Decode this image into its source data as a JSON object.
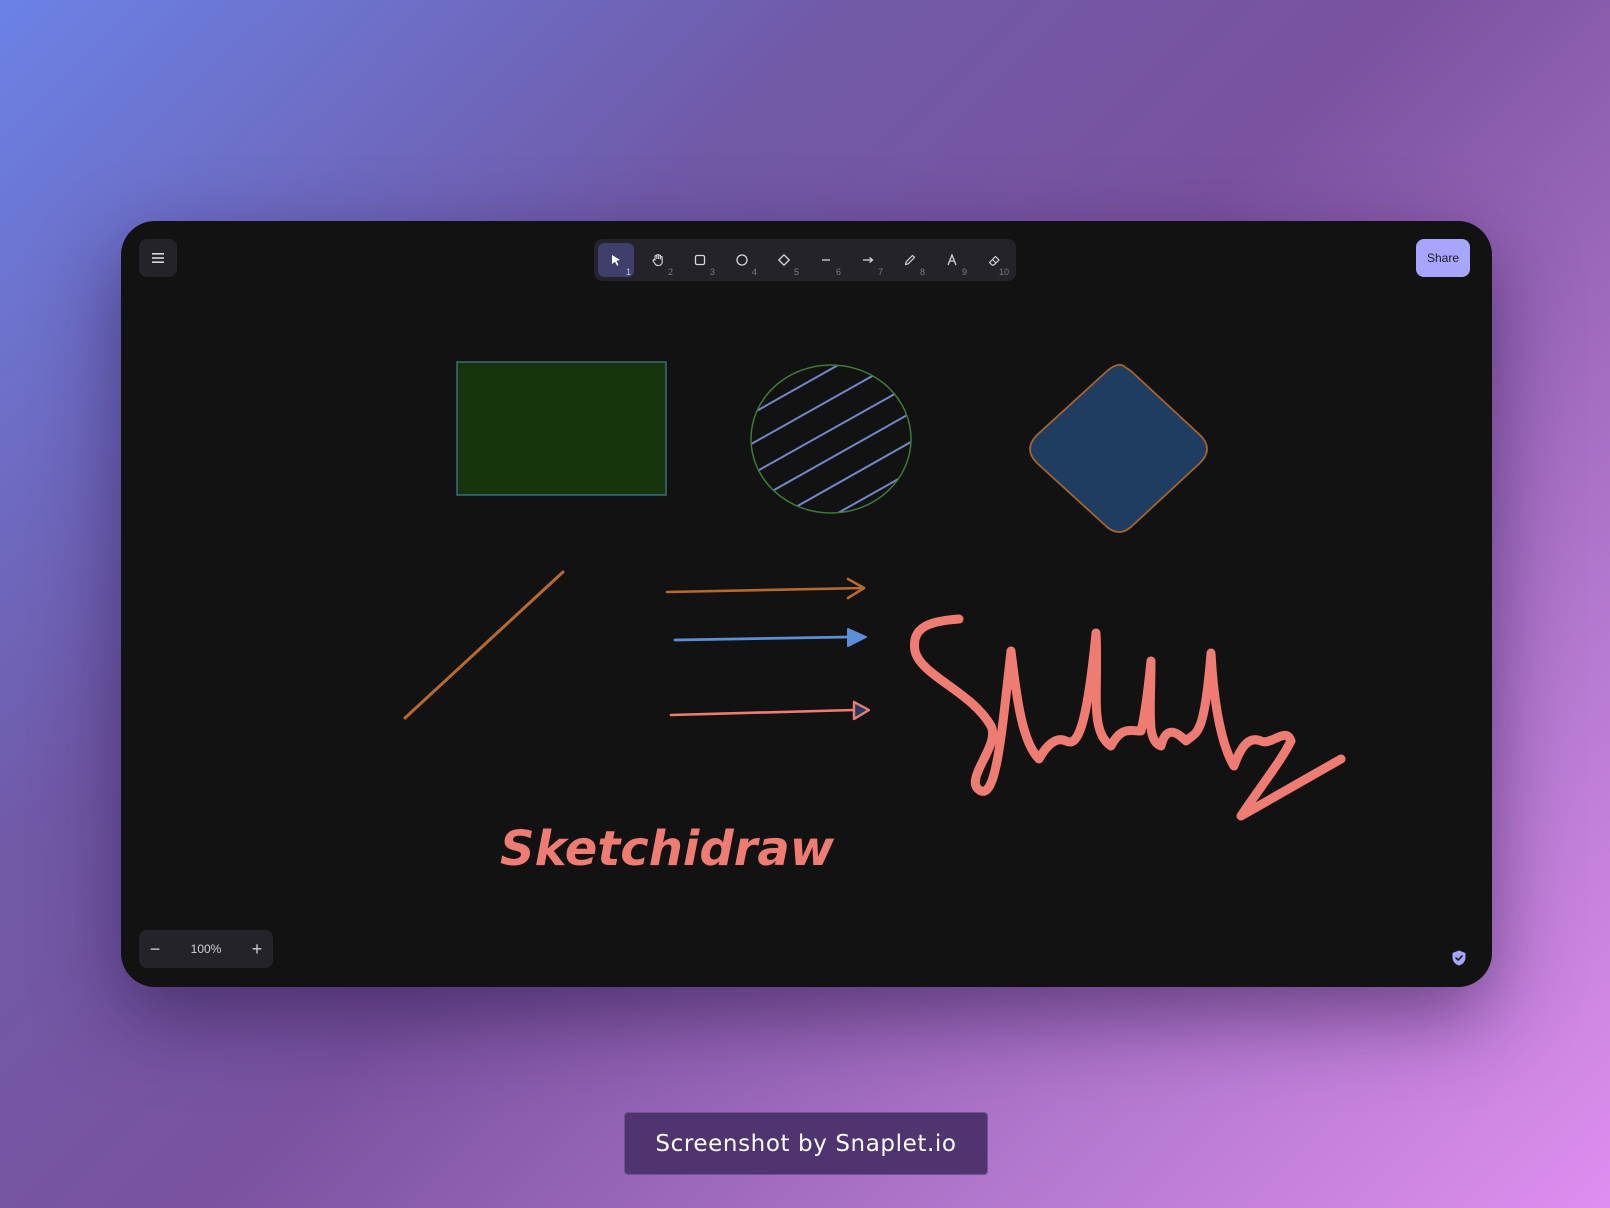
{
  "app": {
    "share_label": "Share",
    "zoom_level": "100%",
    "zoom_out_label": "−",
    "zoom_in_label": "+"
  },
  "toolbar": {
    "tools": [
      {
        "name": "selection",
        "icon": "cursor-icon",
        "key": "1",
        "active": true
      },
      {
        "name": "hand",
        "icon": "hand-icon",
        "key": "2"
      },
      {
        "name": "rectangle",
        "icon": "rectangle-icon",
        "key": "3"
      },
      {
        "name": "ellipse",
        "icon": "circle-icon",
        "key": "4"
      },
      {
        "name": "diamond",
        "icon": "diamond-icon",
        "key": "5"
      },
      {
        "name": "line",
        "icon": "line-icon",
        "key": "6"
      },
      {
        "name": "arrow",
        "icon": "arrow-icon",
        "key": "7"
      },
      {
        "name": "draw",
        "icon": "pencil-icon",
        "key": "8"
      },
      {
        "name": "text",
        "icon": "text-icon",
        "key": "9"
      },
      {
        "name": "eraser",
        "icon": "eraser-icon",
        "key": "10"
      }
    ]
  },
  "canvas": {
    "text_element": "Sketchidraw"
  },
  "colors": {
    "background": "#121212",
    "rect_fill": "#17350c",
    "rect_stroke": "#3d6b7a",
    "ellipse_stroke": "#3f7a3a",
    "hatch": "#7288c8",
    "diamond_fill": "#1f3d61",
    "diamond_stroke": "#a6632a",
    "orange": "#b8692c",
    "blue": "#5b8fd6",
    "salmon": "#ee7c72",
    "accent": "#a8a5ff"
  },
  "credit": "Screenshot by Snaplet.io"
}
